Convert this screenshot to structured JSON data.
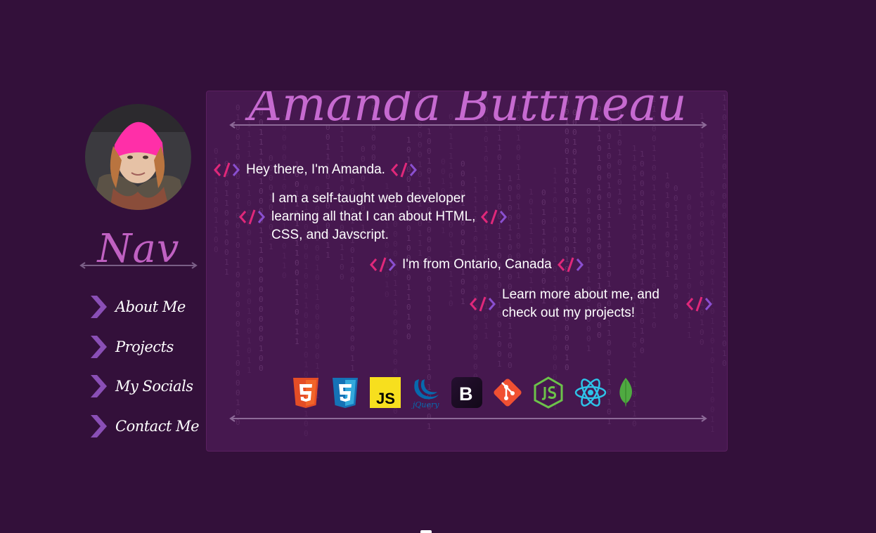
{
  "profile": {
    "name": "Amanda Buttineau",
    "avatar_alt": "Amanda profile photo"
  },
  "nav": {
    "title": "Nav",
    "items": [
      {
        "label": "About Me"
      },
      {
        "label": "Projects"
      },
      {
        "label": "My Socials"
      },
      {
        "label": "Contact Me"
      }
    ]
  },
  "intro": {
    "lines": [
      "Hey there, I'm Amanda.",
      "I am a self-taught web developer learning all that I can about HTML, CSS, and Javscript.",
      "I'm from Ontario, Canada",
      "Learn more about me, and check out my projects!"
    ],
    "line2_parts": [
      "I am a self-taught web developer",
      "learning all that I can about HTML,",
      "CSS, and Javscript."
    ],
    "line4_parts": [
      "Learn more about me, and",
      "check out my projects!"
    ]
  },
  "tech_icons": [
    "html5-icon",
    "css3-icon",
    "javascript-icon",
    "jquery-icon",
    "bootstrap-icon",
    "git-icon",
    "nodejs-icon",
    "react-icon",
    "mongodb-icon"
  ],
  "tech_labels": {
    "js": "JS",
    "bootstrap": "B",
    "jquery": "jQuery"
  },
  "colors": {
    "background": "#33103a",
    "panel": "#46184f",
    "accent": "#c66ad0",
    "tag_pink": "#e0287a",
    "tag_purple": "#8a4fd0"
  }
}
